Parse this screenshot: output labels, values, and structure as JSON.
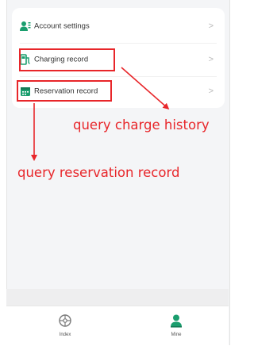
{
  "menu": {
    "items": [
      {
        "label": "Account settings",
        "icon": "user-settings-icon"
      },
      {
        "label": "Charging record",
        "icon": "charging-pump-icon"
      },
      {
        "label": "Reservation record",
        "icon": "calendar-icon"
      }
    ],
    "chevron": ">"
  },
  "annotations": {
    "charge": "query charge history",
    "reservation": "query reservation record"
  },
  "tabbar": {
    "tabs": [
      {
        "label": "Index",
        "icon": "index-icon"
      },
      {
        "label": "Mine",
        "icon": "person-icon"
      }
    ]
  },
  "colors": {
    "highlight": "#e8262a",
    "accent": "#1a9e6e"
  }
}
